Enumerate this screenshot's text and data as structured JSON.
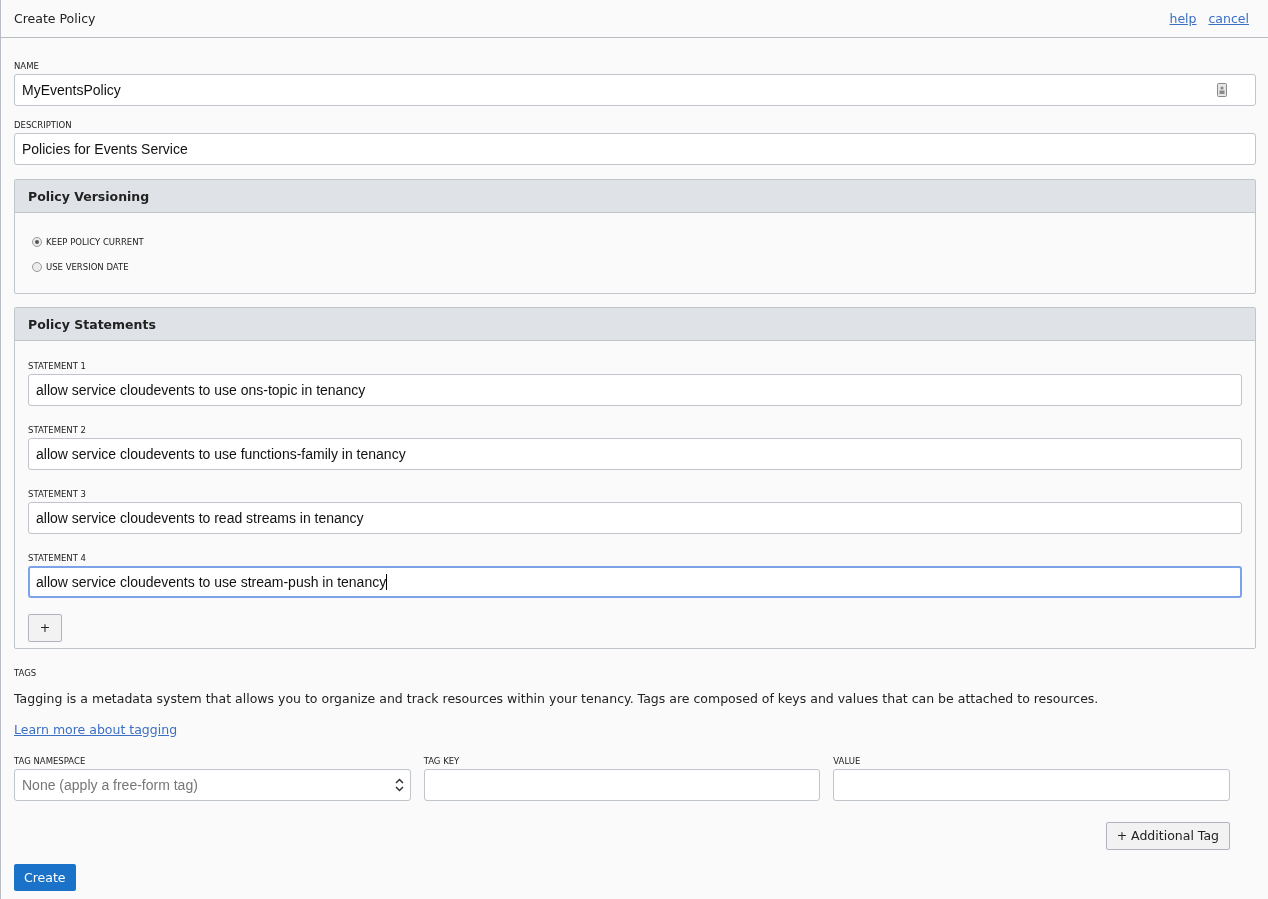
{
  "header": {
    "title": "Create Policy",
    "links": [
      "help",
      "cancel"
    ]
  },
  "name": {
    "label": "NAME",
    "value": "MyEventsPolicy"
  },
  "description": {
    "label": "DESCRIPTION",
    "value": "Policies for Events Service"
  },
  "versioning": {
    "title": "Policy Versioning",
    "options": [
      {
        "label": "KEEP POLICY CURRENT",
        "selected": true
      },
      {
        "label": "USE VERSION DATE",
        "selected": false
      }
    ]
  },
  "statements": {
    "title": "Policy Statements",
    "items": [
      {
        "label": "STATEMENT 1",
        "value": "allow service cloudevents to use ons-topic in tenancy",
        "focused": false
      },
      {
        "label": "STATEMENT 2",
        "value": "allow service cloudevents to use functions-family in tenancy",
        "focused": false
      },
      {
        "label": "STATEMENT 3",
        "value": "allow service cloudevents to read streams in tenancy",
        "focused": false
      },
      {
        "label": "STATEMENT 4",
        "value": "allow service cloudevents to use stream-push in tenancy",
        "focused": true
      }
    ],
    "add_button": "+"
  },
  "tags": {
    "label": "TAGS",
    "description": "Tagging is a metadata system that allows you to organize and track resources within your tenancy. Tags are composed of keys and values that can be attached to resources.",
    "link": "Learn more about tagging",
    "fields": [
      {
        "kind": "select",
        "label": "TAG NAMESPACE",
        "value": "None (apply a free-form tag)"
      },
      {
        "kind": "text",
        "label": "TAG KEY"
      },
      {
        "kind": "text",
        "label": "VALUE"
      }
    ],
    "add_button": "+ Additional Tag"
  },
  "create_button": "Create"
}
